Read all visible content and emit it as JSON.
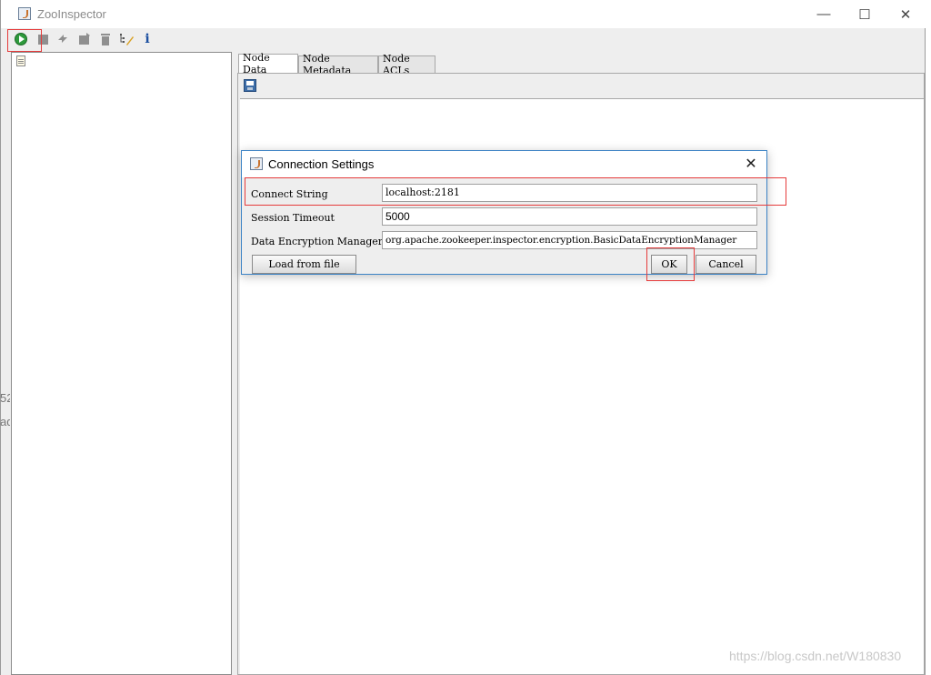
{
  "window": {
    "title": "ZooInspector",
    "minimize_glyph": "—",
    "maximize_glyph": "☐",
    "close_glyph": "✕"
  },
  "toolbar": {
    "items": [
      {
        "icon": "connect-icon"
      },
      {
        "icon": "disconnect-icon"
      },
      {
        "icon": "refresh-icon"
      },
      {
        "icon": "add-node-icon"
      },
      {
        "icon": "delete-node-icon"
      },
      {
        "icon": "node-viewers-icon"
      },
      {
        "icon": "info-icon",
        "glyph": "i"
      }
    ]
  },
  "tabs": [
    {
      "label": "Node Data"
    },
    {
      "label": "Node Metadata"
    },
    {
      "label": "Node ACLs"
    }
  ],
  "left_edge_text": [
    "52",
    "ad"
  ],
  "dialog": {
    "title": "Connection Settings",
    "close_glyph": "✕",
    "fields": [
      {
        "label": "Connect String",
        "value": "localhost:2181"
      },
      {
        "label": "Session Timeout",
        "value": "5000"
      },
      {
        "label": "Data Encryption Manager",
        "value": "org.apache.zookeeper.inspector.encryption.BasicDataEncryptionManager"
      }
    ],
    "load_button": "Load from file",
    "ok_button": "OK",
    "cancel_button": "Cancel"
  },
  "watermark": "https://blog.csdn.net/W180830",
  "colors": {
    "annotation": "#e53b3b",
    "dialog_border": "#3c83c5",
    "connect_green": "#2e9a3c"
  }
}
